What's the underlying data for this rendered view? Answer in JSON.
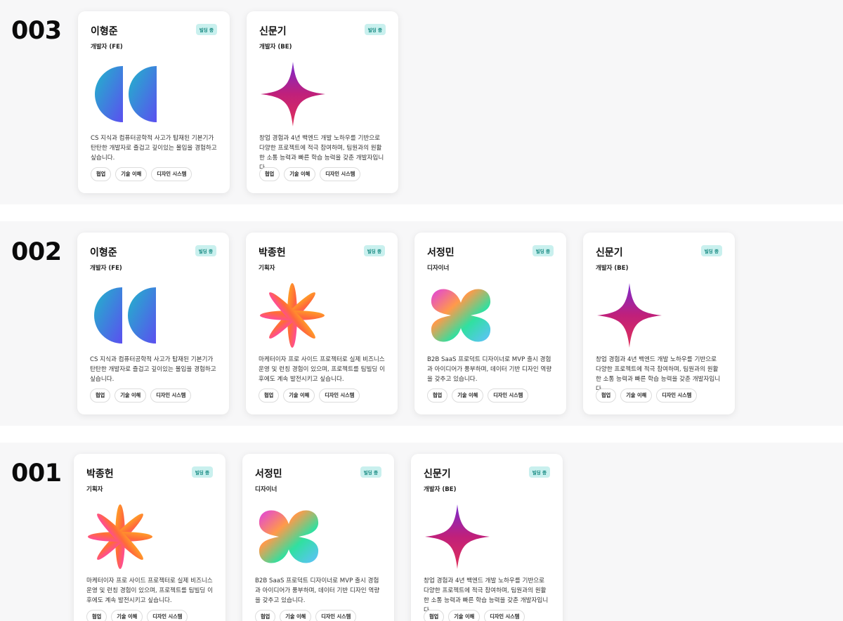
{
  "badge_label": "빌딩 중",
  "sections": [
    {
      "number": "003",
      "cards": [
        {
          "name": "이형준",
          "role": "개발자 (FE)",
          "badge": "빌딩 중",
          "art": "half-circles-icon",
          "desc": "CS 지식과 컴퓨터공학적 사고가 탑재된 기본기가 탄탄한 개발자로 즐겁고 깊이있는 몰입을 경험하고 싶습니다.",
          "tags": [
            "협업",
            "기술 이해",
            "디자인 시스템"
          ]
        },
        {
          "name": "신문기",
          "role": "개발자 (BE)",
          "badge": "빌딩 중",
          "art": "sparkle-star-icon",
          "desc": "창업 경험과 4년 백엔드 개발 노하우를 기반으로 다양한 프로젝트에 적극 참여하며, 팀원과의 원활한 소통 능력과 빠른 학습 능력을 갖춘 개발자입니다.",
          "tags": [
            "협업",
            "기술 이해",
            "디자인 시스템"
          ]
        }
      ]
    },
    {
      "number": "002",
      "cards": [
        {
          "name": "이형준",
          "role": "개발자 (FE)",
          "badge": "빌딩 중",
          "art": "half-circles-icon",
          "desc": "CS 지식과 컴퓨터공학적 사고가 탑재된 기본기가 탄탄한 개발자로 즐겁고 깊이있는 몰입을 경험하고 싶습니다.",
          "tags": [
            "협업",
            "기술 이해",
            "디자인 시스템"
          ]
        },
        {
          "name": "박종헌",
          "role": "기획자",
          "badge": "빌딩 중",
          "art": "flower-petals-icon",
          "desc": "마케터이자 프로 사이드 프로젝터로 실제 비즈니스 운영 및 런칭 경험이 있으며, 프로젝트를 팀빌딩 이후에도 계속 발전시키고 싶습니다.",
          "tags": [
            "협업",
            "기술 이해",
            "디자인 시스템"
          ]
        },
        {
          "name": "서정민",
          "role": "디자이너",
          "badge": "빌딩 중",
          "art": "clover-blob-icon",
          "desc": "B2B SaaS 프로덕트 디자이너로 MVP 출시 경험과 아이디어가 풍부하며, 데이터 기반 디자인 역량을 갖추고 있습니다.",
          "tags": [
            "협업",
            "기술 이해",
            "디자인 시스템"
          ]
        },
        {
          "name": "신문기",
          "role": "개발자 (BE)",
          "badge": "빌딩 중",
          "art": "sparkle-star-icon",
          "desc": "창업 경험과 4년 백엔드 개발 노하우를 기반으로 다양한 프로젝트에 적극 참여하며, 팀원과의 원활한 소통 능력과 빠른 학습 능력을 갖춘 개발자입니다.",
          "tags": [
            "협업",
            "기술 이해",
            "디자인 시스템"
          ]
        }
      ]
    },
    {
      "number": "001",
      "cards": [
        {
          "name": "박종헌",
          "role": "기획자",
          "badge": "빌딩 중",
          "art": "flower-petals-icon",
          "desc": "마케터이자 프로 사이드 프로젝터로 실제 비즈니스 운영 및 런칭 경험이 있으며, 프로젝트를 팀빌딩 이후에도 계속 발전시키고 싶습니다.",
          "tags": [
            "협업",
            "기술 이해",
            "디자인 시스템"
          ]
        },
        {
          "name": "서정민",
          "role": "디자이너",
          "badge": "빌딩 중",
          "art": "clover-blob-icon",
          "desc": "B2B SaaS 프로덕트 디자이너로 MVP 출시 경험과 아이디어가 풍부하며, 데이터 기반 디자인 역량을 갖추고 있습니다.",
          "tags": [
            "협업",
            "기술 이해",
            "디자인 시스템"
          ]
        },
        {
          "name": "신문기",
          "role": "개발자 (BE)",
          "badge": "빌딩 중",
          "art": "sparkle-star-icon",
          "desc": "창업 경험과 4년 백엔드 개발 노하우를 기반으로 다양한 프로젝트에 적극 참여하며, 팀원과의 원활한 소통 능력과 빠른 학습 능력을 갖춘 개발자입니다.",
          "tags": [
            "협업",
            "기술 이해",
            "디자인 시스템"
          ]
        }
      ]
    }
  ],
  "colors": {
    "badge_bg": "#c9f0ee",
    "badge_text": "#178a82",
    "section_bg": "#f7f7f8"
  }
}
